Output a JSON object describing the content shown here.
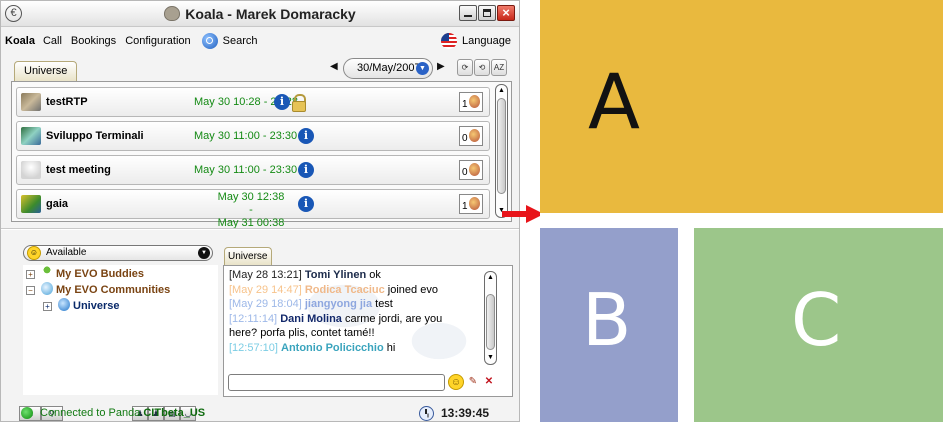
{
  "window": {
    "title": "Koala - Marek Domaracky",
    "controls": [
      "minimize-icon",
      "maximize-icon",
      "close-icon"
    ]
  },
  "menu": {
    "items": [
      "Koala",
      "Call",
      "Bookings",
      "Configuration"
    ],
    "search_label": "Search",
    "language_label": "Language"
  },
  "meetings_tab": "Universe",
  "date_picker": {
    "value": "30/May/2007"
  },
  "sort_button": "AZ",
  "meetings": [
    {
      "name": "testRTP",
      "time": "May 30 10:28 - 22:28",
      "participants": "1",
      "locked": true
    },
    {
      "name": "Sviluppo Terminali",
      "time": "May 30 11:00 - 23:30",
      "participants": "0",
      "locked": false
    },
    {
      "name": "test meeting",
      "time": "May 30 11:00 - 23:30",
      "participants": "0",
      "locked": false
    },
    {
      "name": "gaia",
      "time_line1": "May 30 12:38 -",
      "time_line2": "May 31 00:38",
      "participants": "1",
      "locked": false
    }
  ],
  "presence": {
    "status": "Available"
  },
  "tree": [
    {
      "label": "My EVO Buddies",
      "expander": "+"
    },
    {
      "label": "My EVO Communities",
      "expander": "−"
    },
    {
      "label": "Universe",
      "expander": "+"
    }
  ],
  "chat": {
    "tab": "Universe",
    "messages": [
      {
        "time": "[May 28 13:21]",
        "user": "Tomi Ylinen",
        "text": " ok"
      },
      {
        "time": "[May 29 14:47]",
        "user": "Rodica Tcaciuc",
        "text": " joined evo"
      },
      {
        "time": "[May 29 18:04]",
        "user": "jiangyong jia",
        "text": " test"
      },
      {
        "time": "[12:11:14]",
        "user": "Dani Molina",
        "text": " carme jordi, are you"
      },
      {
        "time": "",
        "user": "",
        "text": "here? porfa plis, contet tamé!!"
      },
      {
        "time": "[12:57:10]",
        "user": "Antonio Policicchio",
        "text": " hi"
      }
    ],
    "input_value": ""
  },
  "statusbar": {
    "connection_prefix": "Connected to Panda ",
    "server": "CITbeta_US",
    "clock": "13:39:45"
  },
  "tiles": {
    "a": "A",
    "b": "B",
    "c": "C"
  },
  "colors": {
    "tile_a": "#e9b93e",
    "tile_b": "#949fcb",
    "tile_c": "#9cc68a",
    "arrow": "#e8141a",
    "connected": "#127a12",
    "meeting_time": "#148a14"
  }
}
